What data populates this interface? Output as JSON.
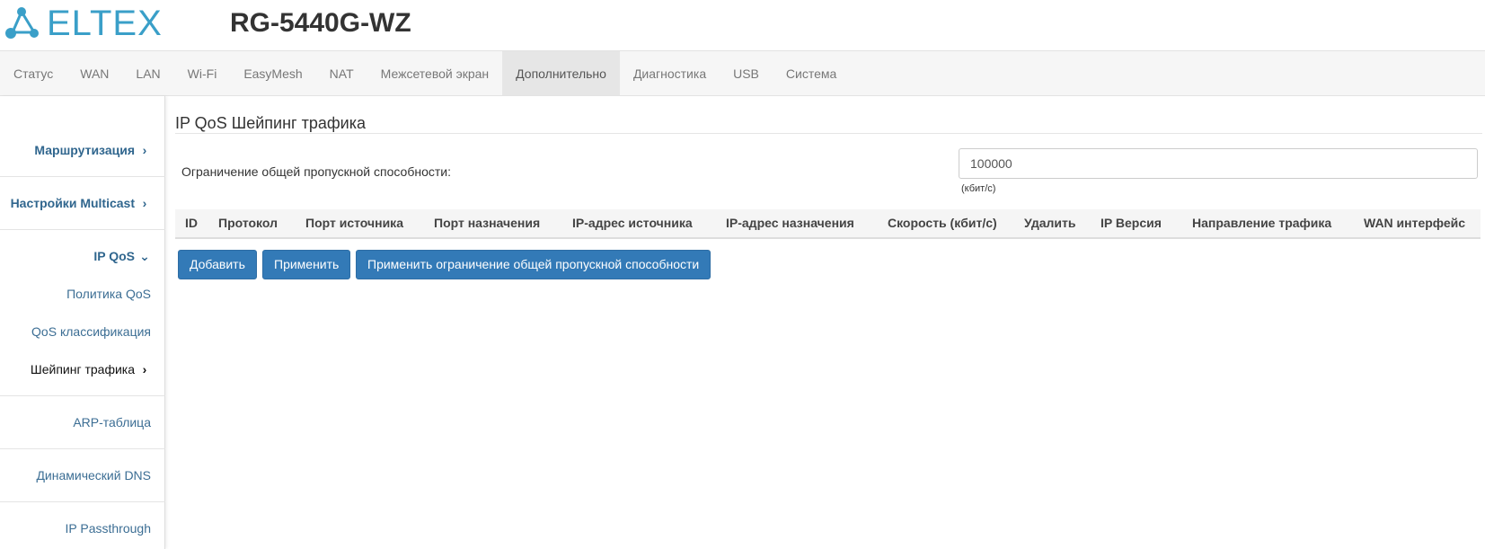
{
  "header": {
    "logo_text": "ELTEX",
    "model": "RG-5440G-WZ"
  },
  "topnav": {
    "tabs": [
      {
        "label": "Статус"
      },
      {
        "label": "WAN"
      },
      {
        "label": "LAN"
      },
      {
        "label": "Wi-Fi"
      },
      {
        "label": "EasyMesh"
      },
      {
        "label": "NAT"
      },
      {
        "label": "Межсетевой экран"
      },
      {
        "label": "Дополнительно",
        "active": true
      },
      {
        "label": "Диагностика"
      },
      {
        "label": "USB"
      },
      {
        "label": "Система"
      }
    ]
  },
  "sidebar": {
    "routing": "Маршрутизация",
    "multicast": "Настройки Multicast",
    "ipqos": "IP QoS",
    "qos_policy": "Политика QoS",
    "qos_class": "QoS классификация",
    "shaping": "Шейпинг трафика",
    "arp": "ARP-таблица",
    "ddns": "Динамический DNS",
    "passthrough": "IP Passthrough"
  },
  "main": {
    "title": "IP QoS Шейпинг трафика",
    "bandwidth_label": "Ограничение общей пропускной способности:",
    "bandwidth_value": "100000",
    "bandwidth_unit": "(кбит/с)",
    "columns": [
      "ID",
      "Протокол",
      "Порт источника",
      "Порт назначения",
      "IP-адрес источника",
      "IP-адрес назначения",
      "Скорость (кбит/с)",
      "Удалить",
      "IP Версия",
      "Направление трафика",
      "WAN интерфейс"
    ],
    "buttons": {
      "add": "Добавить",
      "apply": "Применить",
      "apply_limit": "Применить ограничение общей пропускной способности"
    }
  },
  "colors": {
    "accent": "#337ab7",
    "logo": "#3a9fc8",
    "sidebar_link": "#3c6e94"
  },
  "icons": {
    "logo": "eltex-logo-icon",
    "chevron_right": "chevron-right-icon",
    "chevron_down": "chevron-down-icon"
  }
}
